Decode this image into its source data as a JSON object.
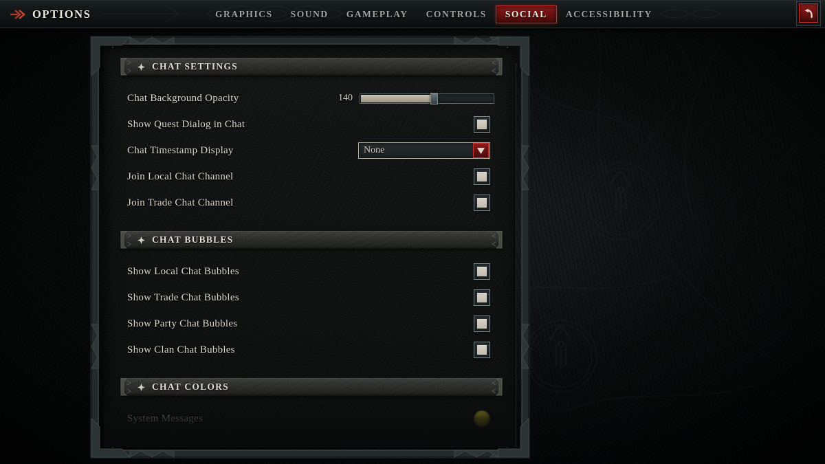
{
  "header": {
    "title": "OPTIONS",
    "title_icon": "double-arrow-icon",
    "back_button_icon": "back-arrow-icon",
    "tabs": [
      {
        "label": "GRAPHICS",
        "active": false
      },
      {
        "label": "SOUND",
        "active": false
      },
      {
        "label": "GAMEPLAY",
        "active": false
      },
      {
        "label": "CONTROLS",
        "active": false
      },
      {
        "label": "SOCIAL",
        "active": true
      },
      {
        "label": "ACCESSIBILITY",
        "active": false
      }
    ]
  },
  "colors": {
    "accent_red": "#8d1c1c",
    "accent_red_border": "#c9332c",
    "text_primary": "#ddd7cb",
    "text_heading": "#e3ded3",
    "slider_fill": "#b2ab9a",
    "checkbox_fill": "#d7d2c6",
    "scrollbar_thumb": "#b8b2a2",
    "system_messages_swatch": "#b8a317"
  },
  "sections": [
    {
      "title": "CHAT SETTINGS",
      "ornament": "diamond-ornament-icon",
      "rows": [
        {
          "label": "Chat Background Opacity",
          "control": "slider",
          "value": "140",
          "percent": 55
        },
        {
          "label": "Show Quest Dialog in Chat",
          "control": "checkbox",
          "checked": true
        },
        {
          "label": "Chat Timestamp Display",
          "control": "dropdown",
          "value": "None"
        },
        {
          "label": "Join Local Chat Channel",
          "control": "checkbox",
          "checked": true
        },
        {
          "label": "Join Trade Chat Channel",
          "control": "checkbox",
          "checked": true
        }
      ]
    },
    {
      "title": "CHAT BUBBLES",
      "ornament": "diamond-ornament-icon",
      "rows": [
        {
          "label": "Show Local Chat Bubbles",
          "control": "checkbox",
          "checked": true
        },
        {
          "label": "Show Trade Chat Bubbles",
          "control": "checkbox",
          "checked": true
        },
        {
          "label": "Show Party Chat Bubbles",
          "control": "checkbox",
          "checked": true
        },
        {
          "label": "Show Clan Chat Bubbles",
          "control": "checkbox",
          "checked": true
        }
      ]
    },
    {
      "title": "CHAT COLORS",
      "ornament": "diamond-ornament-icon",
      "rows": [
        {
          "label": "System Messages",
          "control": "swatch",
          "color": "#b8a317"
        }
      ]
    }
  ],
  "scrollbar": {
    "up_icon": "scroll-up-arrow-icon",
    "down_icon": "scroll-down-arrow-icon",
    "thumb_top_percent": 36,
    "thumb_height_percent": 39
  }
}
